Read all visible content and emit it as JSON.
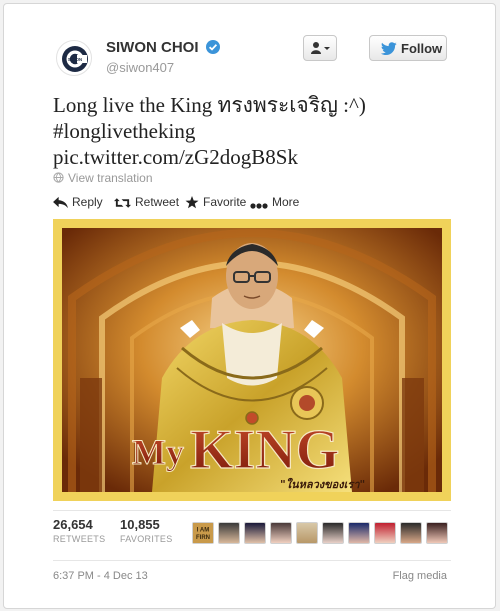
{
  "profile": {
    "display_name": "SIWON CHOI",
    "handle": "@siwon407",
    "logo_text": "SIWON",
    "logo_icon": "circle-c-logo",
    "verified_icon": "verified-badge-icon"
  },
  "buttons": {
    "user_actions_icon": "person-dropdown-icon",
    "follow_label": "Follow",
    "follow_icon": "twitter-bird-icon"
  },
  "tweet": {
    "line1": "Long live the King ทรงพระเจริญ :^)",
    "line2": "#longlivetheking",
    "line3": "pic.twitter.com/zG2dogB8Sk",
    "view_translation": "View translation"
  },
  "actions": {
    "reply": "Reply",
    "retweet": "Retweet",
    "favorite": "Favorite",
    "more": "More"
  },
  "media": {
    "title_my": "My",
    "title_king": "KING",
    "caption": "\"ในหลวงของเรา\""
  },
  "stats": {
    "retweets": "26,654",
    "retweets_label": "RETWEETS",
    "favorites": "10,855",
    "favorites_label": "FAVORITES",
    "iamfirn_top": "I AM",
    "iamfirn_bottom": "FIRN"
  },
  "footer": {
    "timestamp": "6:37 PM - 4 Dec 13",
    "flag": "Flag media"
  },
  "colors": {
    "accent": "#2a7ab0",
    "verified": "#3b94d9",
    "media_frame": "#f0d25a"
  }
}
